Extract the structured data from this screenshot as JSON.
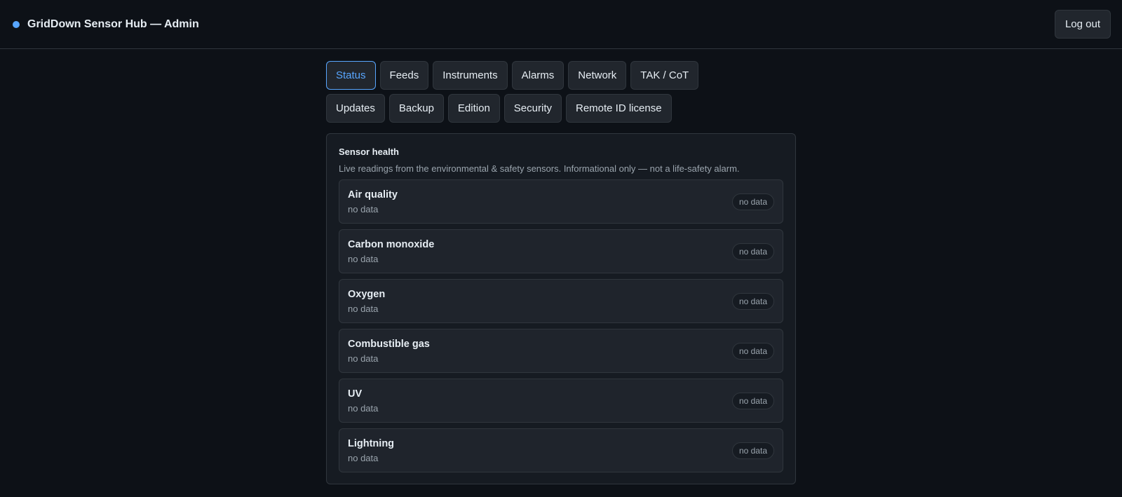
{
  "header": {
    "title": "GridDown Sensor Hub — Admin",
    "logout_label": "Log out",
    "status_dot_color": "#58a6ff"
  },
  "tabs": [
    {
      "label": "Status",
      "active": true
    },
    {
      "label": "Feeds",
      "active": false
    },
    {
      "label": "Instruments",
      "active": false
    },
    {
      "label": "Alarms",
      "active": false
    },
    {
      "label": "Network",
      "active": false
    },
    {
      "label": "TAK / CoT",
      "active": false
    },
    {
      "label": "Updates",
      "active": false
    },
    {
      "label": "Backup",
      "active": false
    },
    {
      "label": "Edition",
      "active": false
    },
    {
      "label": "Security",
      "active": false
    },
    {
      "label": "Remote ID license",
      "active": false
    }
  ],
  "panel": {
    "title": "Sensor health",
    "subtitle": "Live readings from the environmental & safety sensors. Informational only — not a life-safety alarm.",
    "sensors": [
      {
        "name": "Air quality",
        "value": "no data",
        "badge": "no data"
      },
      {
        "name": "Carbon monoxide",
        "value": "no data",
        "badge": "no data"
      },
      {
        "name": "Oxygen",
        "value": "no data",
        "badge": "no data"
      },
      {
        "name": "Combustible gas",
        "value": "no data",
        "badge": "no data"
      },
      {
        "name": "UV",
        "value": "no data",
        "badge": "no data"
      },
      {
        "name": "Lightning",
        "value": "no data",
        "badge": "no data"
      }
    ]
  },
  "colors": {
    "accent": "#58a6ff",
    "background": "#0d1117"
  }
}
